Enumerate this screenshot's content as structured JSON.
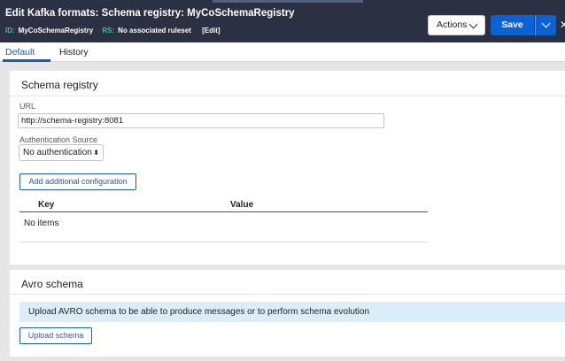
{
  "header": {
    "title": "Edit  Kafka formats: Schema registry: MyCoSchemaRegistry",
    "id_label": "ID:",
    "id_value": "MyCoSchemaRegistry",
    "rs_label": "RS:",
    "rs_value": "No associated ruleset",
    "edit_link": "[Edit]",
    "actions_label": "Actions",
    "save_label": "Save",
    "close_glyph": "✕"
  },
  "tabs": [
    {
      "label": "Default",
      "active": true
    },
    {
      "label": "History",
      "active": false
    }
  ],
  "schema_registry": {
    "title": "Schema registry",
    "url_label": "URL",
    "url_value": "http://schema-registry:8081",
    "auth_label": "Authentication Source",
    "auth_value": "No authentication",
    "add_config_label": "Add additional configuration",
    "table": {
      "columns": [
        "Key",
        "Value"
      ],
      "empty_text": "No items"
    }
  },
  "avro_schema": {
    "title": "Avro schema",
    "banner_text": "Upload AVRO schema to be able to produce messages or to perform schema evolution",
    "upload_label": "Upload schema"
  },
  "colors": {
    "header_bg": "#2b3043",
    "accent_blue": "#0a63d6",
    "id_label_color": "#3dbf9f",
    "banner_bg": "#d9eef8"
  }
}
